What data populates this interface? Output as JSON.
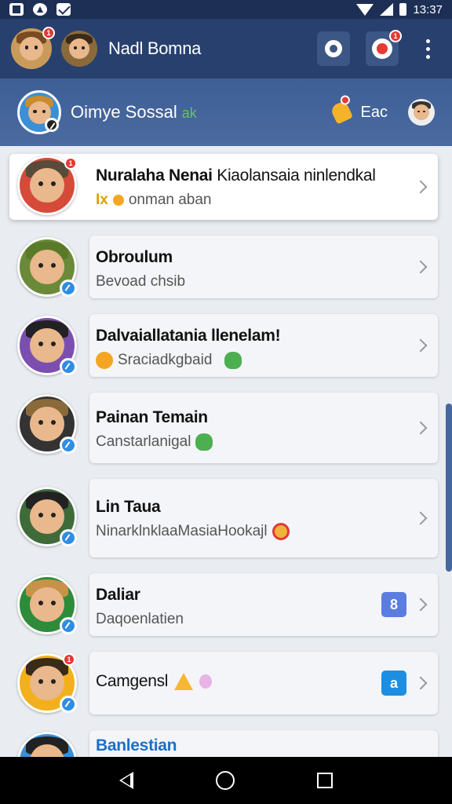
{
  "status_bar": {
    "time": "13:37",
    "left_icons": [
      "n-icon",
      "app-icon",
      "mail-icon"
    ],
    "right_icons": [
      "wifi-icon",
      "signal-icon",
      "battery-icon"
    ]
  },
  "top_bar": {
    "title": "Nadl Bomna",
    "avatar_badge": "1",
    "action_badge": "1",
    "actions": [
      "gear-icon",
      "target-icon",
      "more-vert-icon"
    ]
  },
  "sub_bar": {
    "title": "Oimye Sossal",
    "tag": "ak",
    "right_label": "Eac"
  },
  "contacts": [
    {
      "name_bold": "Nuralaha Nenai",
      "name_light": "Kiaolansaia ninlendkal",
      "subtitle_prefix": "Ix",
      "subtitle": "onman aban",
      "badge": "1",
      "app_badge": "",
      "app_color": "",
      "emoji": ""
    },
    {
      "name_bold": "Obroulum",
      "name_light": "",
      "subtitle_prefix": "",
      "subtitle": "Bevoad chsib",
      "badge": "",
      "app_badge": "",
      "app_color": "",
      "emoji": ""
    },
    {
      "name_bold": "Dalvaiallatania llenelam!",
      "name_light": "",
      "subtitle_prefix": "",
      "subtitle": "Sraciadkgbaid",
      "badge": "",
      "app_badge": "",
      "app_color": "",
      "emoji": "green-blob"
    },
    {
      "name_bold": "Painan Temain",
      "name_light": "",
      "subtitle_prefix": "",
      "subtitle": "Canstarlanigal",
      "badge": "",
      "app_badge": "",
      "app_color": "",
      "emoji": "green-blob"
    },
    {
      "name_bold": "Lin Taua",
      "name_light": "",
      "subtitle_prefix": "",
      "subtitle": "NinarklnklaaMasiaHookajl",
      "badge": "",
      "app_badge": "",
      "app_color": "",
      "emoji": "red-face"
    },
    {
      "name_bold": "Daliar",
      "name_light": "",
      "subtitle_prefix": "",
      "subtitle": "Daqoenlatien",
      "badge": "",
      "app_badge": "8",
      "app_color": "#5b7de0",
      "emoji": ""
    },
    {
      "name_bold": "Camgensl",
      "name_light": "",
      "subtitle_prefix": "",
      "subtitle": "",
      "badge": "1",
      "app_badge": "a",
      "app_color": "#1c8fe3",
      "emoji": "triangle"
    },
    {
      "name_bold": "Banlestian",
      "name_light": "",
      "subtitle_prefix": "",
      "subtitle": "",
      "badge": "",
      "app_badge": "",
      "app_color": "",
      "emoji": ""
    }
  ]
}
